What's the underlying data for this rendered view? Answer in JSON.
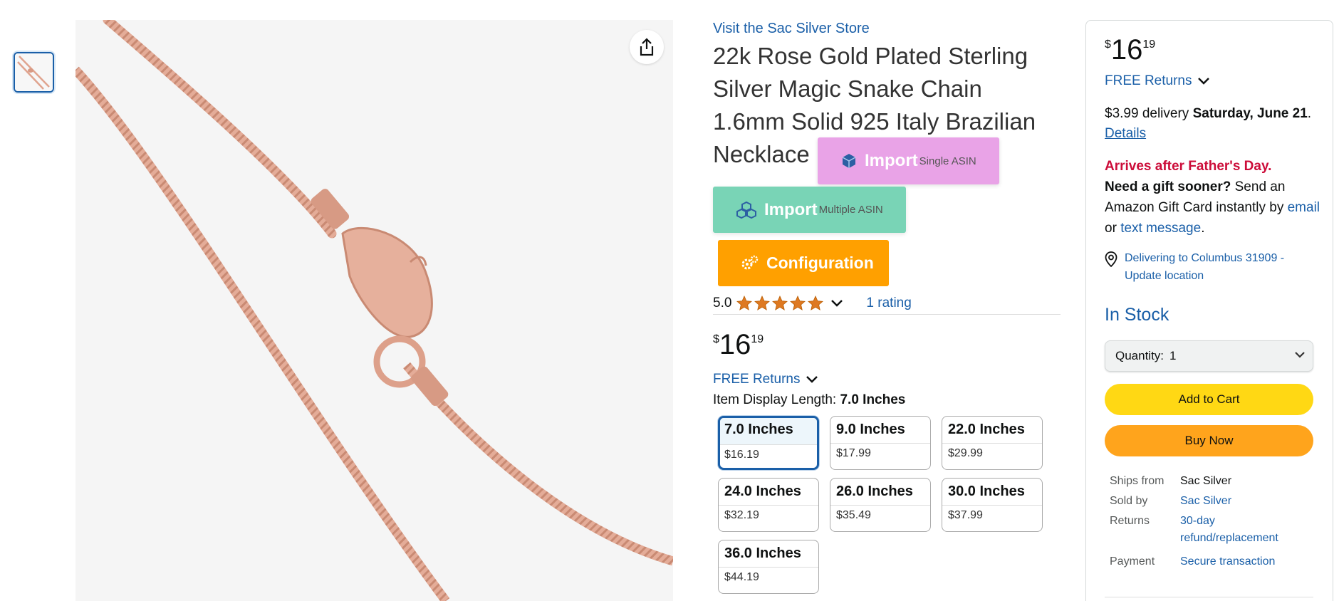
{
  "product": {
    "store_link": "Visit the Sac Silver Store",
    "title": "22k Rose Gold Plated Sterling Silver Magic Snake Chain 1.6mm Solid 925 Italy Brazilian Necklace",
    "rating": "5.0",
    "stars": 5,
    "rating_count": "1 rating",
    "price": {
      "symbol": "$",
      "whole": "16",
      "fraction": "19"
    },
    "free_returns": "FREE Returns",
    "length_label": "Item Display Length: ",
    "length_value": "7.0 Inches",
    "variants": [
      {
        "name": "7.0 Inches",
        "price": "$16.19",
        "selected": true
      },
      {
        "name": "9.0 Inches",
        "price": "$17.99"
      },
      {
        "name": "22.0 Inches",
        "price": "$29.99"
      },
      {
        "name": "24.0 Inches",
        "price": "$32.19"
      },
      {
        "name": "26.0 Inches",
        "price": "$35.49"
      },
      {
        "name": "30.0 Inches",
        "price": "$37.99"
      },
      {
        "name": "36.0 Inches",
        "price": "$44.19"
      }
    ]
  },
  "extension": {
    "import_single": {
      "label": "Import",
      "sub": "Single ASIN",
      "color": "#e9a3e7"
    },
    "import_multiple": {
      "label": "Import",
      "sub": "Multiple ASIN",
      "color": "#79d4b6"
    },
    "configuration": {
      "label": "Configuration",
      "color": "#ffa000"
    }
  },
  "buybox": {
    "price": {
      "symbol": "$",
      "whole": "16",
      "fraction": "19"
    },
    "free_returns": "FREE Returns",
    "delivery_prefix": "$3.99 delivery ",
    "delivery_date": "Saturday, June 21",
    "delivery_sep": ". ",
    "details_link": "Details",
    "gift_alert": "Arrives after Father's Day.",
    "gift_question": "Need a gift sooner?",
    "gift_text": " Send an Amazon Gift Card instantly by ",
    "gift_email": "email",
    "gift_or": " or ",
    "gift_text_message": "text message",
    "gift_end": ".",
    "location": "Delivering to Columbus 31909 - Update location",
    "stock": "In Stock",
    "quantity_label": "Quantity:",
    "quantity_value": "1",
    "add_to_cart": "Add to Cart",
    "buy_now": "Buy Now",
    "info": [
      {
        "label": "Ships from",
        "value": "Sac Silver",
        "link": false
      },
      {
        "label": "Sold by",
        "value": "Sac Silver",
        "link": true
      },
      {
        "label": "Returns",
        "value": "30-day refund/replacement",
        "link": true
      },
      {
        "label": "Payment",
        "value": "Secure transaction",
        "link": true
      }
    ]
  },
  "colors": {
    "link": "#1a5fa8",
    "add_to_cart": "#ffd814",
    "buy_now": "#ffa41c",
    "alert_red": "#cc0c39",
    "star": "#de7921",
    "chain": "#e0a48f"
  },
  "icons": [
    "share-icon",
    "cube-icon",
    "cubes-icon",
    "gears-icon",
    "star-icon",
    "chevron-down-icon",
    "location-pin-icon"
  ]
}
